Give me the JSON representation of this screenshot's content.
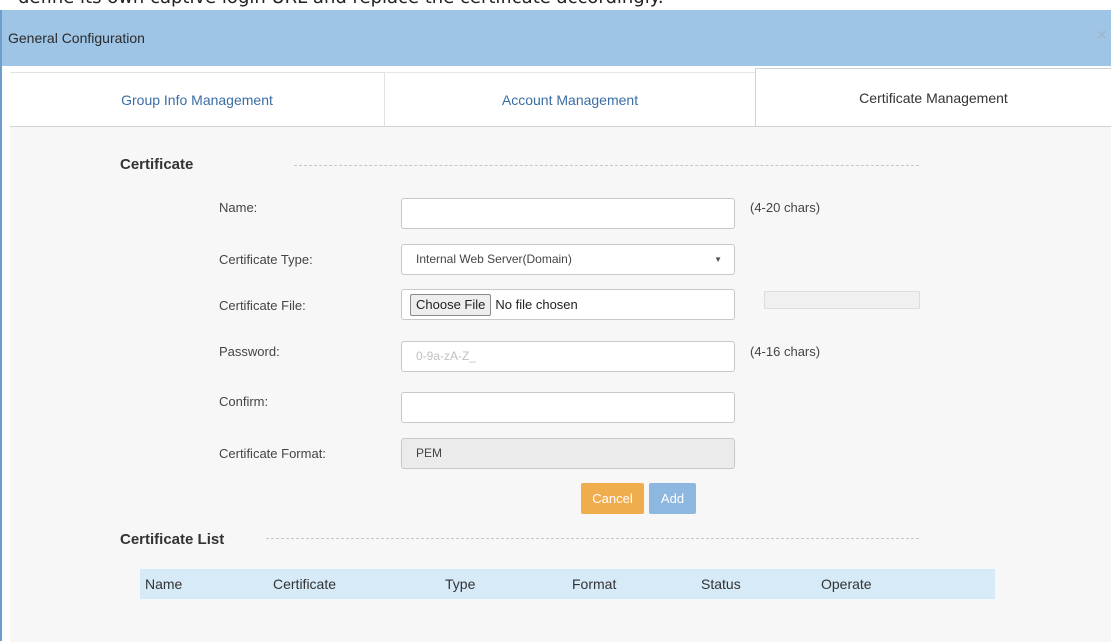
{
  "doc_text": "define its own captive login URL and replace the certificate accordingly.",
  "dialog": {
    "title": "General Configuration",
    "close_glyph": "×"
  },
  "tabs": [
    {
      "label": "Group Info Management",
      "active": false
    },
    {
      "label": "Account Management",
      "active": false
    },
    {
      "label": "Certificate Management",
      "active": true
    }
  ],
  "certificate": {
    "section_title": "Certificate",
    "name": {
      "label": "Name:",
      "value": "",
      "hint": "(4-20 chars)"
    },
    "type": {
      "label": "Certificate Type:",
      "value": "Internal Web Server(Domain)",
      "arrow_glyph": "▼"
    },
    "file": {
      "label": "Certificate File:",
      "button_label": "Choose File",
      "status": "No file chosen"
    },
    "password": {
      "label": "Password:",
      "value": "",
      "placeholder": "0-9a-zA-Z_",
      "hint": "(4-16 chars)"
    },
    "confirm": {
      "label": "Confirm:",
      "value": ""
    },
    "format": {
      "label": "Certificate Format:",
      "value": "PEM"
    }
  },
  "buttons": {
    "cancel": "Cancel",
    "add": "Add"
  },
  "certificate_list": {
    "section_title": "Certificate List",
    "columns": [
      "Name",
      "Certificate",
      "Type",
      "Format",
      "Status",
      "Operate"
    ],
    "rows": []
  },
  "colors": {
    "titlebar": "#9ec4e6",
    "tab_link": "#3a6ea5",
    "cancel_button": "#f0ad4e",
    "add_button": "#8db7df",
    "table_header": "#d6eaf8"
  }
}
